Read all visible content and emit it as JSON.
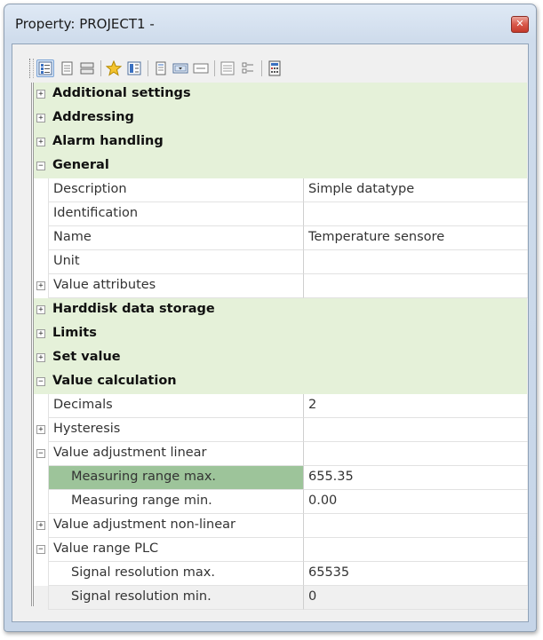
{
  "window": {
    "title": "Property: PROJECT1 -",
    "close_label": "✕"
  },
  "toolbar": {
    "buttons": [
      {
        "icon": "categorized-view-icon",
        "active": true
      },
      {
        "icon": "property-pages-icon",
        "active": false
      },
      {
        "icon": "events-icon",
        "active": false
      },
      {
        "icon": "favorites-star-icon",
        "active": false
      },
      {
        "icon": "show-all-icon",
        "active": false
      },
      {
        "icon": "description-icon",
        "active": false
      },
      {
        "icon": "expand-field-icon",
        "active": false
      },
      {
        "icon": "collapse-field-icon",
        "active": false
      },
      {
        "icon": "expand-all-icon",
        "active": false
      },
      {
        "icon": "collapse-all-icon",
        "active": false
      },
      {
        "icon": "calculator-icon",
        "active": false
      }
    ]
  },
  "grid": {
    "rows": [
      {
        "type": "category",
        "label": "Additional settings",
        "toggle": "+"
      },
      {
        "type": "category",
        "label": "Addressing",
        "toggle": "+"
      },
      {
        "type": "category",
        "label": "Alarm handling",
        "toggle": "+"
      },
      {
        "type": "category",
        "label": "General",
        "toggle": "−"
      },
      {
        "type": "property",
        "name": "Description",
        "value": "Simple datatype"
      },
      {
        "type": "property",
        "name": "Identification",
        "value": ""
      },
      {
        "type": "property",
        "name": "Name",
        "value": "Temperature sensore"
      },
      {
        "type": "property",
        "name": "Unit",
        "value": ""
      },
      {
        "type": "property",
        "name": "Value attributes",
        "value": "",
        "toggle": "+"
      },
      {
        "type": "category",
        "label": "Harddisk data storage",
        "toggle": "+"
      },
      {
        "type": "category",
        "label": "Limits",
        "toggle": "+"
      },
      {
        "type": "category",
        "label": "Set value",
        "toggle": "+"
      },
      {
        "type": "category",
        "label": "Value calculation",
        "toggle": "−"
      },
      {
        "type": "property",
        "name": "Decimals",
        "value": "2"
      },
      {
        "type": "property",
        "name": "Hysteresis",
        "value": "",
        "toggle": "+"
      },
      {
        "type": "property",
        "name": "Value adjustment linear",
        "value": "",
        "toggle": "−"
      },
      {
        "type": "property",
        "name": "Measuring range max.",
        "value": "655.35",
        "sub": true,
        "selected": true
      },
      {
        "type": "property",
        "name": "Measuring range min.",
        "value": "0.00",
        "sub": true
      },
      {
        "type": "property",
        "name": "Value adjustment non-linear",
        "value": "",
        "toggle": "+"
      },
      {
        "type": "property",
        "name": "Value range PLC",
        "value": "",
        "toggle": "−"
      },
      {
        "type": "property",
        "name": "Signal resolution max.",
        "value": "65535",
        "sub": true
      },
      {
        "type": "property",
        "name": "Signal resolution min.",
        "value": "0",
        "sub": true
      }
    ]
  }
}
